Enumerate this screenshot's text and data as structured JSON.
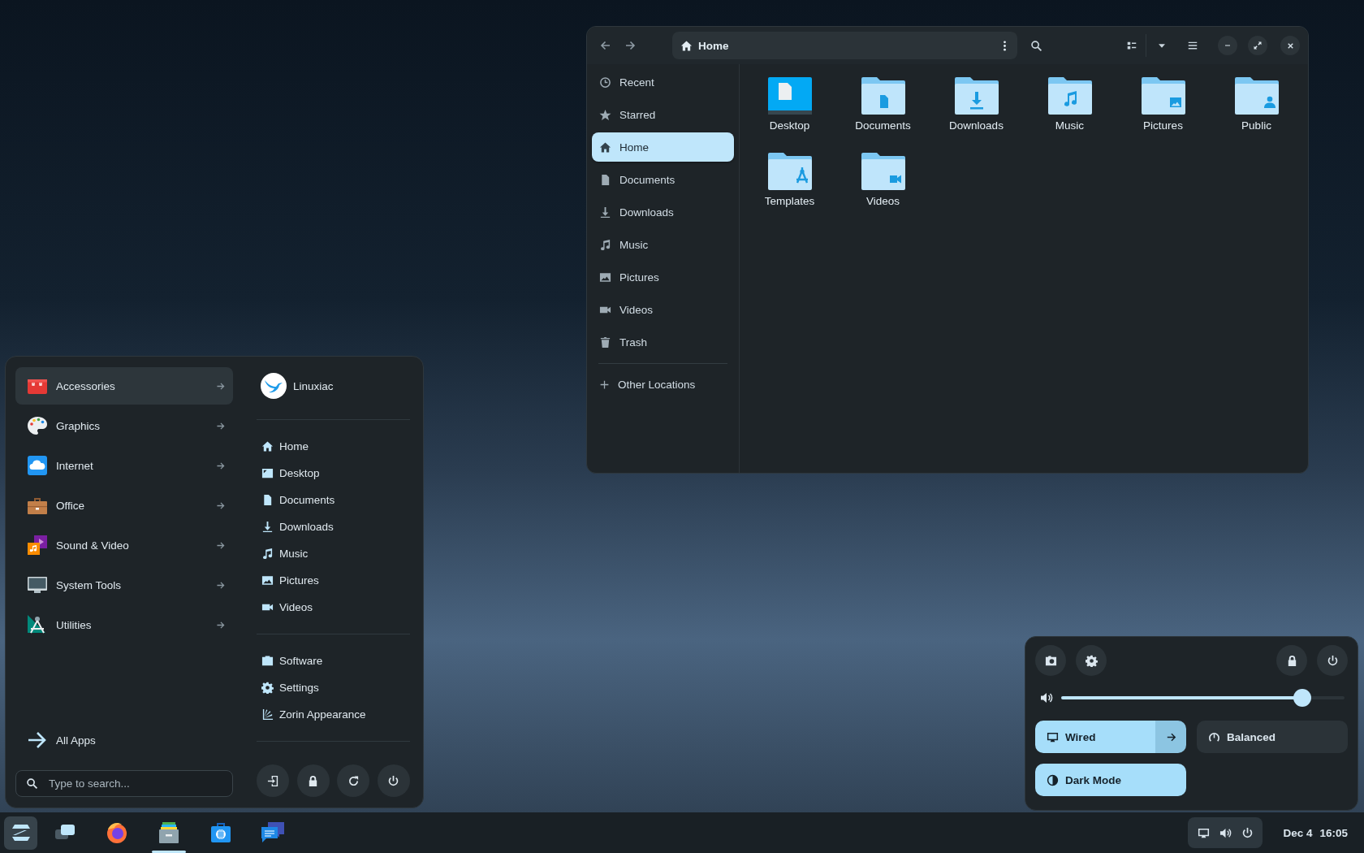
{
  "file_manager": {
    "path": "Home",
    "sidebar": [
      {
        "label": "Recent",
        "selected": false
      },
      {
        "label": "Starred",
        "selected": false
      },
      {
        "label": "Home",
        "selected": true
      },
      {
        "label": "Documents",
        "selected": false
      },
      {
        "label": "Downloads",
        "selected": false
      },
      {
        "label": "Music",
        "selected": false
      },
      {
        "label": "Pictures",
        "selected": false
      },
      {
        "label": "Videos",
        "selected": false
      },
      {
        "label": "Trash",
        "selected": false
      }
    ],
    "other_locations": "Other Locations",
    "folders": [
      "Desktop",
      "Documents",
      "Downloads",
      "Music",
      "Pictures",
      "Public",
      "Templates",
      "Videos"
    ]
  },
  "start_menu": {
    "categories": [
      {
        "label": "Accessories",
        "selected": true
      },
      {
        "label": "Graphics",
        "selected": false
      },
      {
        "label": "Internet",
        "selected": false
      },
      {
        "label": "Office",
        "selected": false
      },
      {
        "label": "Sound & Video",
        "selected": false
      },
      {
        "label": "System Tools",
        "selected": false
      },
      {
        "label": "Utilities",
        "selected": false
      }
    ],
    "all_apps": "All Apps",
    "search": {
      "placeholder": "Type to search..."
    },
    "user": "Linuxiac",
    "places": [
      "Home",
      "Desktop",
      "Documents",
      "Downloads",
      "Music",
      "Pictures",
      "Videos"
    ],
    "apps": [
      "Software",
      "Settings",
      "Zorin Appearance"
    ]
  },
  "quick_settings": {
    "volume": {
      "level": 0.85
    },
    "toggles": [
      {
        "kind": "split",
        "label": "Wired",
        "on": true
      },
      {
        "kind": "plain",
        "label": "Balanced",
        "on": false
      },
      {
        "kind": "plain",
        "label": "Dark Mode",
        "on": true
      }
    ]
  },
  "taskbar": {
    "start_button": {
      "pressed": true
    },
    "apps": [
      {
        "running": false
      },
      {
        "running": false
      },
      {
        "running": true
      },
      {
        "running": false
      },
      {
        "running": false
      }
    ],
    "date": "Dec 4",
    "time": "16:05"
  }
}
